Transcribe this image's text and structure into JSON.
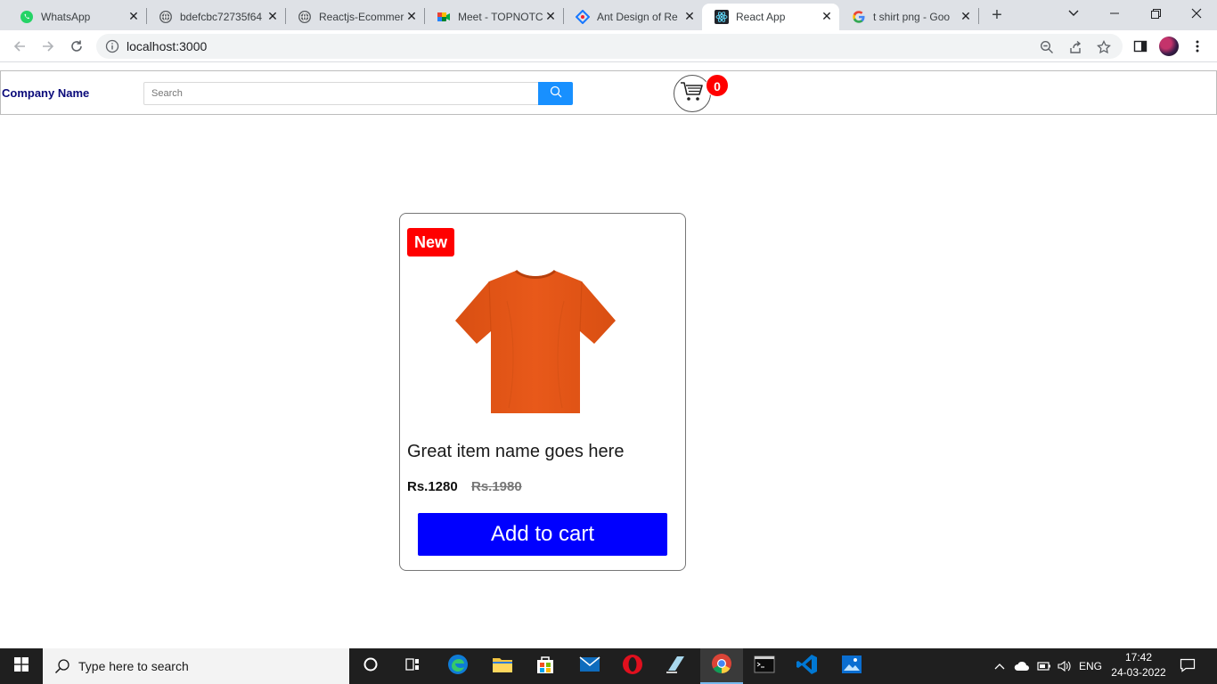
{
  "browser": {
    "tabs": [
      {
        "title": "WhatsApp",
        "icon": "whatsapp-icon"
      },
      {
        "title": "bdefcbc72735f64",
        "icon": "globe-icon"
      },
      {
        "title": "Reactjs-Ecommer",
        "icon": "globe-icon"
      },
      {
        "title": "Meet - TOPNOTC",
        "icon": "google-meet-icon"
      },
      {
        "title": "Ant Design of Re",
        "icon": "ant-design-icon"
      },
      {
        "title": "React App",
        "icon": "react-icon"
      },
      {
        "title": "t shirt png - Goo",
        "icon": "google-icon"
      }
    ],
    "url": "localhost:3000"
  },
  "header": {
    "company_name": "Company Name",
    "search_placeholder": "Search",
    "cart_count": "0"
  },
  "product": {
    "badge": "New",
    "name": "Great item name goes here",
    "price": "Rs.1280",
    "old_price": "Rs.1980",
    "add_to_cart_label": "Add to cart",
    "shirt_color": "#e8591a"
  },
  "taskbar": {
    "search_placeholder": "Type here to search",
    "language": "ENG",
    "time": "17:42",
    "date": "24-03-2022"
  },
  "colors": {
    "accent_blue": "#0000ff",
    "search_button": "#1890ff",
    "badge_red": "#ff0000",
    "brand_text": "#0a0a7a"
  }
}
